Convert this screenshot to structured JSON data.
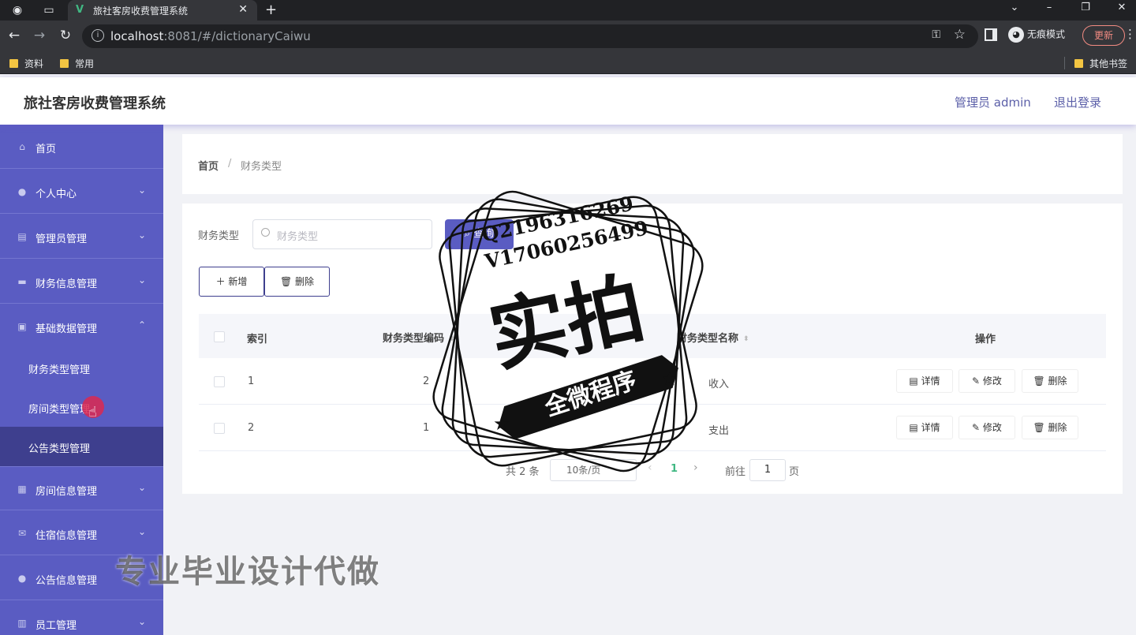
{
  "browser": {
    "tab_title": "旅社客房收费管理系统",
    "url_host": "localhost",
    "url_rest": ":8081/#/dictionaryCaiwu",
    "incognito_label": "无痕模式",
    "update_label": "更新",
    "bookmarks": [
      "资料",
      "常用"
    ],
    "other_bookmarks": "其他书签"
  },
  "header": {
    "title": "旅社客房收费管理系统",
    "admin_label": "管理员 admin",
    "logout_label": "退出登录"
  },
  "sidebar": {
    "items": [
      {
        "label": "首页",
        "icon": "home-icon"
      },
      {
        "label": "个人中心",
        "icon": "user-icon"
      },
      {
        "label": "管理员管理",
        "icon": "admin-icon"
      },
      {
        "label": "财务信息管理",
        "icon": "finance-icon"
      },
      {
        "label": "基础数据管理",
        "icon": "data-icon"
      },
      {
        "label": "房间信息管理",
        "icon": "room-icon"
      },
      {
        "label": "住宿信息管理",
        "icon": "mail-icon"
      },
      {
        "label": "公告信息管理",
        "icon": "notice-icon"
      },
      {
        "label": "员工管理",
        "icon": "chart-icon"
      }
    ],
    "submenu": [
      "财务类型管理",
      "房间类型管理",
      "公告类型管理"
    ]
  },
  "breadcrumb": {
    "home": "首页",
    "separator": "/",
    "current": "财务类型"
  },
  "search": {
    "label": "财务类型",
    "placeholder": "财务类型",
    "button": "查询"
  },
  "actions": {
    "add": "新增",
    "delete": "删除"
  },
  "table": {
    "headers": [
      "索引",
      "财务类型编码",
      "财务类型名称",
      "操作"
    ],
    "rows": [
      {
        "index": "1",
        "code": "2",
        "name": "收入"
      },
      {
        "index": "2",
        "code": "1",
        "name": "支出"
      }
    ],
    "row_actions": {
      "detail": "详情",
      "edit": "修改",
      "delete": "删除"
    }
  },
  "pagination": {
    "total": "共 2 条",
    "page_size": "10条/页",
    "current_page": "1",
    "goto_label": "前往",
    "goto_value": "1",
    "page_suffix": "页"
  },
  "watermark": {
    "line1": "Q2196316269",
    "line2": "V17060256499",
    "big": "实拍",
    "ribbon": "全微程序",
    "promo": "专业毕业设计代做"
  },
  "colors": {
    "sidebar_bg": "#5a5cc2",
    "sidebar_active": "#3e3f8e",
    "accent": "#5a5cc2",
    "page_number": "#41b883"
  }
}
